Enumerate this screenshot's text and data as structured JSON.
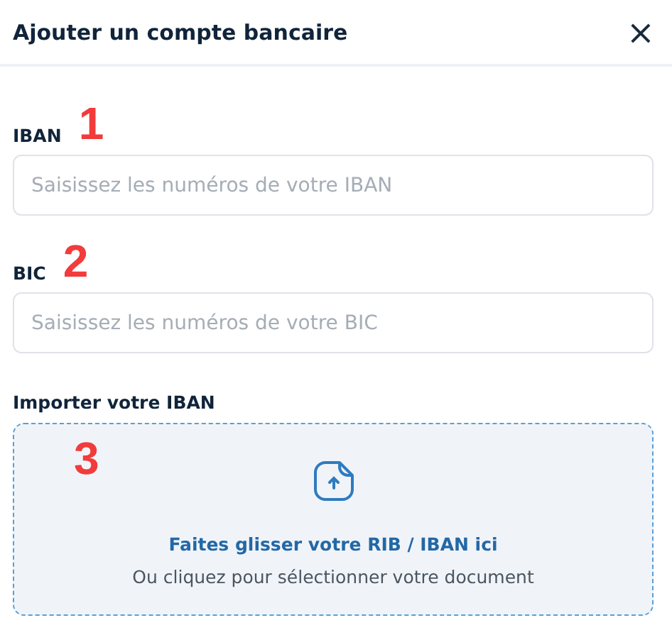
{
  "dialog": {
    "title": "Ajouter un compte bancaire",
    "close": "×"
  },
  "fields": [
    {
      "label": "IBAN",
      "annotation": "1",
      "placeholder": "Saisissez les numéros de votre IBAN"
    },
    {
      "label": "BIC",
      "annotation": "2",
      "placeholder": "Saisissez les numéros de votre BIC"
    }
  ],
  "upload": {
    "label": "Importer votre IBAN",
    "annotation": "3",
    "title": "Faites glisser votre RIB / IBAN ici",
    "hint": "Ou cliquez pour sélectionner votre document"
  }
}
